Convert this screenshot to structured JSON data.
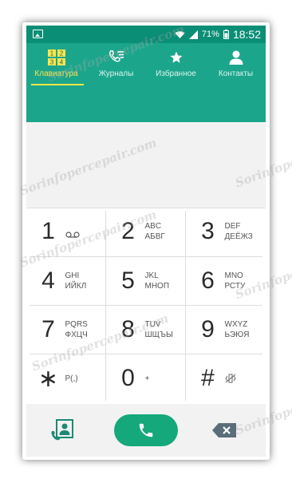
{
  "status_bar": {
    "battery": "71%",
    "time": "18:52"
  },
  "tabs": [
    {
      "label": "Клавиатура",
      "icon": "keypad-icon",
      "active": true
    },
    {
      "label": "Журналы",
      "icon": "call-log-icon",
      "active": false
    },
    {
      "label": "Избранное",
      "icon": "star-icon",
      "active": false
    },
    {
      "label": "Контакты",
      "icon": "person-icon",
      "active": false
    }
  ],
  "keypad_grid_icon_digits": [
    "1",
    "2",
    "3",
    "4"
  ],
  "keys": [
    {
      "digit": "1",
      "l1": "",
      "l2": "",
      "voicemail": true
    },
    {
      "digit": "2",
      "l1": "ABC",
      "l2": "АБВГ"
    },
    {
      "digit": "3",
      "l1": "DEF",
      "l2": "ДЕЁЖЗ"
    },
    {
      "digit": "4",
      "l1": "GHI",
      "l2": "ИЙКЛ"
    },
    {
      "digit": "5",
      "l1": "JKL",
      "l2": "МНОП"
    },
    {
      "digit": "6",
      "l1": "MNO",
      "l2": "РСТУ"
    },
    {
      "digit": "7",
      "l1": "PQRS",
      "l2": "ФХЦЧ"
    },
    {
      "digit": "8",
      "l1": "TUV",
      "l2": "ШЩЪЫ"
    },
    {
      "digit": "9",
      "l1": "WXYZ",
      "l2": "ЬЭЮЯ"
    },
    {
      "digit": "∗",
      "l1": "P(,)",
      "l2": ""
    },
    {
      "digit": "0",
      "l1": "+",
      "l2": ""
    },
    {
      "digit": "#",
      "l1": "",
      "l2": "",
      "mute": true
    }
  ],
  "watermark": "Sorinfopercepair.com",
  "colors": {
    "header": "#1ba68b",
    "status_bar": "#0b8e76",
    "active_tab": "#ffe54d",
    "call_button": "#14a87a"
  }
}
